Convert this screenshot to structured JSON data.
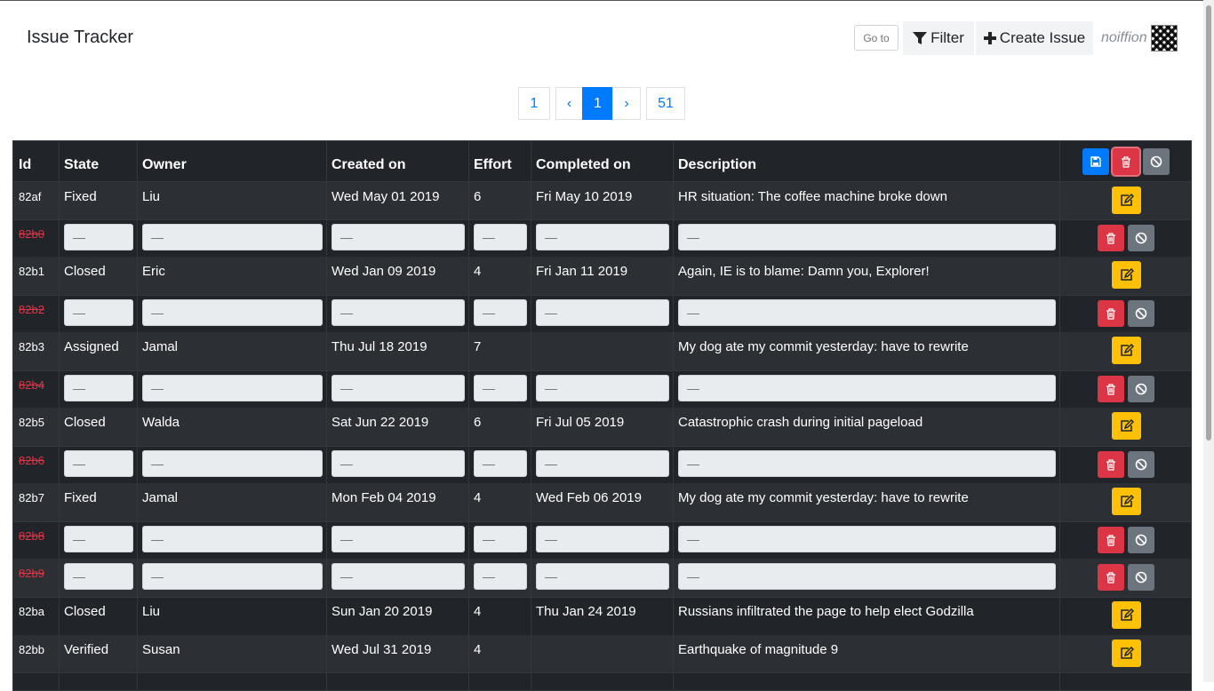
{
  "app": {
    "title": "Issue Tracker"
  },
  "toolbar": {
    "goto_placeholder": "Go to",
    "filter_label": "Filter",
    "create_label": "Create Issue",
    "username": "noiffion"
  },
  "pagination": {
    "first": "1",
    "prev": "‹",
    "current": "1",
    "next": "›",
    "last": "51"
  },
  "table": {
    "headers": [
      "Id",
      "State",
      "Owner",
      "Created on",
      "Effort",
      "Completed on",
      "Description"
    ],
    "empty_placeholder": "—",
    "rows": [
      {
        "id": "82af",
        "deleted": false,
        "state": "Fixed",
        "owner": "Liu",
        "created": "Wed May 01 2019",
        "effort": "6",
        "completed": "Fri May 10 2019",
        "description": "HR situation: The coffee machine broke down"
      },
      {
        "id": "82b0",
        "deleted": true
      },
      {
        "id": "82b1",
        "deleted": false,
        "state": "Closed",
        "owner": "Eric",
        "created": "Wed Jan 09 2019",
        "effort": "4",
        "completed": "Fri Jan 11 2019",
        "description": "Again, IE is to blame: Damn you, Explorer!"
      },
      {
        "id": "82b2",
        "deleted": true
      },
      {
        "id": "82b3",
        "deleted": false,
        "state": "Assigned",
        "owner": "Jamal",
        "created": "Thu Jul 18 2019",
        "effort": "7",
        "completed": "",
        "description": "My dog ate my commit yesterday: have to rewrite"
      },
      {
        "id": "82b4",
        "deleted": true
      },
      {
        "id": "82b5",
        "deleted": false,
        "state": "Closed",
        "owner": "Walda",
        "created": "Sat Jun 22 2019",
        "effort": "6",
        "completed": "Fri Jul 05 2019",
        "description": "Catastrophic crash during initial pageload"
      },
      {
        "id": "82b6",
        "deleted": true
      },
      {
        "id": "82b7",
        "deleted": false,
        "state": "Fixed",
        "owner": "Jamal",
        "created": "Mon Feb 04 2019",
        "effort": "4",
        "completed": "Wed Feb 06 2019",
        "description": "My dog ate my commit yesterday: have to rewrite"
      },
      {
        "id": "82b8",
        "deleted": true
      },
      {
        "id": "82b9",
        "deleted": true
      },
      {
        "id": "82ba",
        "deleted": false,
        "state": "Closed",
        "owner": "Liu",
        "created": "Sun Jan 20 2019",
        "effort": "4",
        "completed": "Thu Jan 24 2019",
        "description": "Russians infiltrated the page to help elect Godzilla"
      },
      {
        "id": "82bb",
        "deleted": false,
        "state": "Verified",
        "owner": "Susan",
        "created": "Wed Jul 31 2019",
        "effort": "4",
        "completed": "",
        "description": "Earthquake of magnitude 9"
      }
    ]
  },
  "colors": {
    "primary": "#007bff",
    "danger": "#dc3545",
    "warning": "#ffc107",
    "secondary": "#6c757d",
    "table_dark": "#212529"
  },
  "icons": {
    "filter": "filter-icon",
    "create": "plus-icon",
    "save": "save-icon",
    "delete": "trash-icon",
    "cancel": "ban-icon",
    "edit": "edit-icon"
  }
}
